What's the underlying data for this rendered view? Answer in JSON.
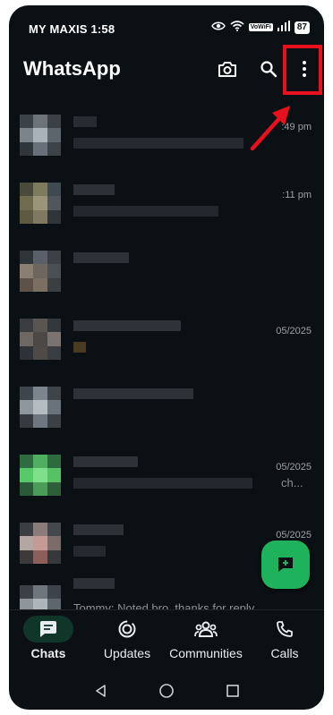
{
  "status_bar": {
    "carrier_time": "MY MAXIS 1:58",
    "vowifi": "VoWiFi",
    "battery": "87"
  },
  "app_bar": {
    "title": "WhatsApp",
    "icons": [
      "camera-icon",
      "search-icon",
      "more-vert-icon"
    ]
  },
  "annotation": {
    "highlight_color": "#e8101c"
  },
  "chats": [
    {
      "time": ":49 pm"
    },
    {
      "time": ":11 pm"
    },
    {
      "time": ""
    },
    {
      "time": "05/2025"
    },
    {
      "time": ""
    },
    {
      "time": "05/2025",
      "preview": "ch..."
    },
    {
      "time": "05/2025"
    },
    {
      "time": "",
      "preview": "Tommy: Noted bro, thanks for reply"
    }
  ],
  "bottom_nav": {
    "items": [
      {
        "label": "Chats",
        "icon": "chats-icon",
        "active": true
      },
      {
        "label": "Updates",
        "icon": "updates-icon",
        "active": false
      },
      {
        "label": "Communities",
        "icon": "communities-icon",
        "active": false
      },
      {
        "label": "Calls",
        "icon": "calls-icon",
        "active": false
      }
    ]
  },
  "colors": {
    "background": "#0b1014",
    "accent": "#21c063",
    "active_pill": "#103529"
  }
}
